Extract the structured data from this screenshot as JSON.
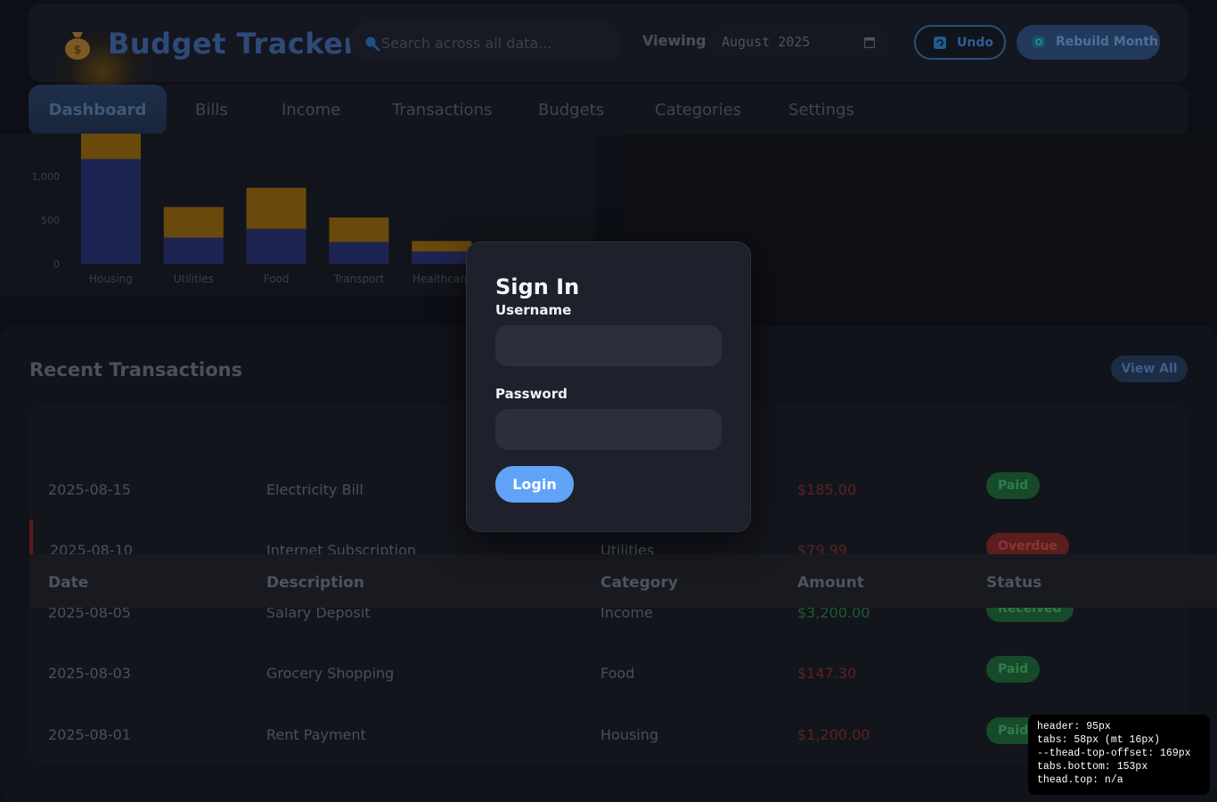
{
  "header": {
    "app_title": "Budget Tracker",
    "search_placeholder": "Search across all data...",
    "viewing_label": "Viewing:",
    "month_value": "August 2025",
    "undo_label": "Undo",
    "rebuild_label": "Rebuild Month"
  },
  "tabs": [
    {
      "label": "Dashboard",
      "active": true
    },
    {
      "label": "Bills"
    },
    {
      "label": "Income"
    },
    {
      "label": "Transactions"
    },
    {
      "label": "Budgets"
    },
    {
      "label": "Categories"
    },
    {
      "label": "Settings"
    }
  ],
  "chart_data": {
    "type": "bar",
    "stacked": true,
    "categories": [
      "Housing",
      "Utilities",
      "Food",
      "Transport",
      "Healthcare",
      ""
    ],
    "series": [
      {
        "color": "#1e2452",
        "values": [
          1200,
          300,
          400,
          250,
          140,
          0
        ]
      },
      {
        "color": "#6a4a0c",
        "values": [
          600,
          350,
          470,
          280,
          120,
          120
        ]
      }
    ],
    "y_ticks": [
      "0",
      "500",
      "1,000"
    ],
    "ylim": [
      0,
      1500
    ],
    "colors": {
      "series_a": "#1e2452",
      "series_b": "#6a4a0c"
    }
  },
  "recent": {
    "title": "Recent Transactions",
    "view_all_label": "View All",
    "columns": [
      "Date",
      "Description",
      "Category",
      "Amount",
      "Status"
    ],
    "rows": [
      {
        "date": "2025-08-15",
        "description": "Electricity Bill",
        "category": "",
        "amount": "$185.00",
        "status": "Paid"
      },
      {
        "date": "2025-08-10",
        "description": "Internet Subscription",
        "category": "Utilities",
        "amount": "$79.99",
        "status": "Overdue"
      },
      {
        "date": "2025-08-05",
        "description": "Salary Deposit",
        "category": "Income",
        "amount": "$3,200.00",
        "status": "Received"
      },
      {
        "date": "2025-08-03",
        "description": "Grocery Shopping",
        "category": "Food",
        "amount": "$147.30",
        "status": "Paid"
      },
      {
        "date": "2025-08-01",
        "description": "Rent Payment",
        "category": "Housing",
        "amount": "$1,200.00",
        "status": "Paid"
      }
    ]
  },
  "modal": {
    "title": "Sign In",
    "username_label": "Username",
    "password_label": "Password",
    "login_label": "Login"
  },
  "debug": [
    "header: 95px",
    "tabs: 58px (mt 16px)",
    "--thead-top-offset: 169px",
    "tabs.bottom: 153px",
    "thead.top: n/a"
  ]
}
